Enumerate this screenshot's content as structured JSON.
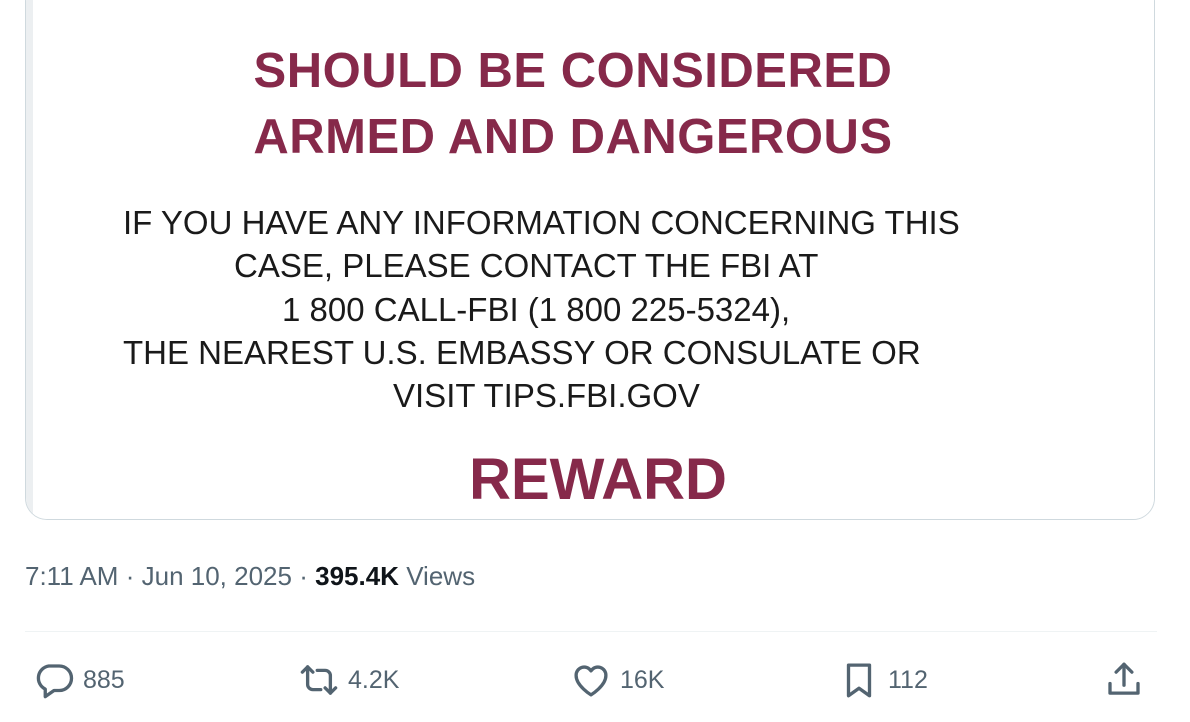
{
  "tweet": {
    "media": {
      "warning_line_1": "SHOULD BE CONSIDERED",
      "warning_line_2": "ARMED AND DANGEROUS",
      "info_lines": [
        "IF YOU HAVE ANY INFORMATION CONCERNING THIS",
        "CASE, PLEASE CONTACT THE FBI AT",
        "1 800 CALL-FBI (1 800 225-5324),",
        "THE NEAREST U.S. EMBASSY OR CONSULATE OR",
        "VISIT TIPS.FBI.GOV"
      ],
      "reward": "REWARD"
    },
    "meta": {
      "time": "7:11 AM",
      "separator": "·",
      "date": "Jun 10, 2025",
      "views_count": "395.4K",
      "views_label": "Views"
    },
    "actions": {
      "replies": "885",
      "reposts": "4.2K",
      "likes": "16K",
      "bookmarks": "112"
    }
  },
  "icons": {
    "reply": "reply-icon",
    "repost": "repost-icon",
    "like": "heart-icon",
    "bookmark": "bookmark-icon",
    "share": "share-icon"
  },
  "colors": {
    "poster_headline": "#86294a",
    "poster_text": "#1a1a1a",
    "secondary_text": "#536471",
    "primary_text": "#0f1419",
    "border": "#cfd9de"
  }
}
